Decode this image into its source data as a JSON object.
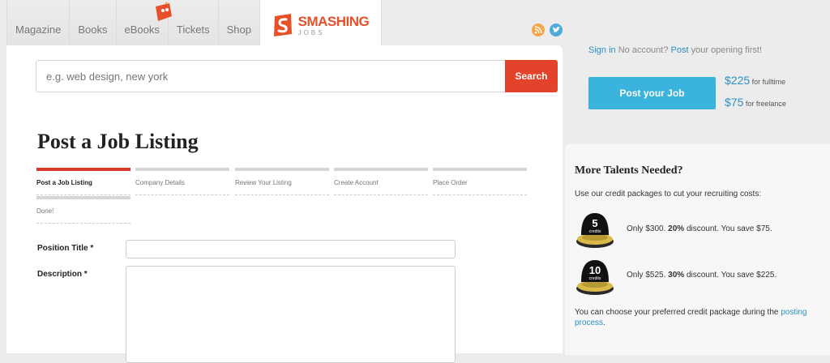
{
  "nav": {
    "items": [
      "Magazine",
      "Books",
      "eBooks",
      "Tickets",
      "Shop"
    ],
    "logo_main": "SMASHING",
    "logo_sub": "JOBS"
  },
  "search": {
    "placeholder": "e.g. web design, new york",
    "button_label": "Search"
  },
  "page_title": "Post a Job Listing",
  "steps": [
    "Post a Job Listing",
    "Company Details",
    "Review Your Listing",
    "Create Account",
    "Place Order",
    "Done!"
  ],
  "form": {
    "position_label": "Position Title *",
    "description_label": "Description *"
  },
  "account": {
    "sign_in": "Sign in",
    "no_account": "No account?",
    "post_link": "Post",
    "post_suffix": "your opening first!"
  },
  "post_job": {
    "button_label": "Post your Job",
    "fulltime_price": "$225",
    "fulltime_label": "for fulltime",
    "freelance_price": "$75",
    "freelance_label": "for freelance"
  },
  "talents": {
    "title": "More Talents Needed?",
    "intro": "Use our credit packages to cut your recruiting costs:",
    "packages": [
      {
        "credits": "5",
        "unit": "credits",
        "price_text": "Only $300.",
        "discount": "20%",
        "discount_label": "discount. You save $75."
      },
      {
        "credits": "10",
        "unit": "credits",
        "price_text": "Only $525.",
        "discount": "30%",
        "discount_label": "discount. You save $225."
      }
    ],
    "outro": "You can choose your preferred credit package during the",
    "outro_link": "posting process",
    "outro_end": "."
  },
  "colors": {
    "accent_red": "#e2432a",
    "accent_blue": "#3ab3dd",
    "link_blue": "#2b8fc4"
  }
}
